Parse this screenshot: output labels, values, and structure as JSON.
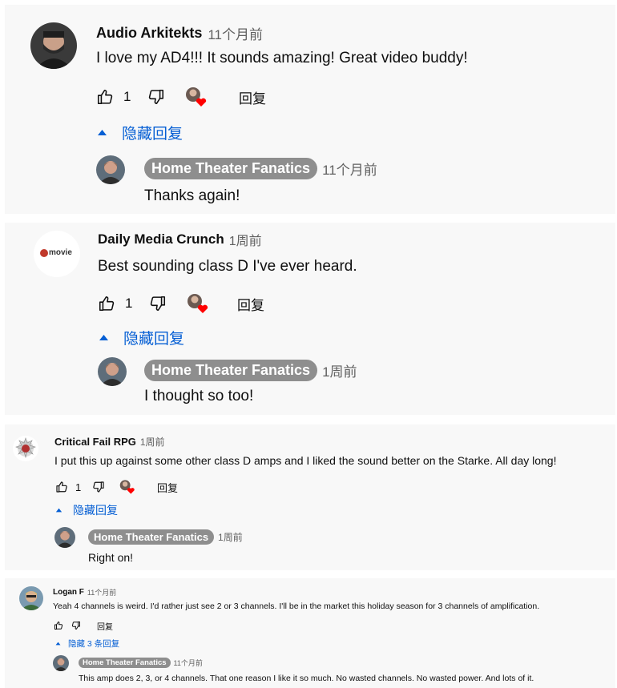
{
  "comments": [
    {
      "author": "Audio Arkitekts",
      "time": "11个月前",
      "text": "I love my AD4!!! It sounds amazing! Great video buddy!",
      "likes": "1",
      "reply_label": "回复",
      "toggle_label": "隐藏回复",
      "reply": {
        "author": "Home Theater Fanatics",
        "time": "11个月前",
        "text": "Thanks again!"
      }
    },
    {
      "author": "Daily Media Crunch",
      "time": "1周前",
      "logo_text": "movie",
      "text": "Best sounding class D I've ever heard.",
      "likes": "1",
      "reply_label": "回复",
      "toggle_label": "隐藏回复",
      "reply": {
        "author": "Home Theater Fanatics",
        "time": "1周前",
        "text": "I thought so too!"
      }
    },
    {
      "author": "Critical Fail RPG",
      "time": "1周前",
      "text": "I put this up against some other class D amps and I liked the sound better on the Starke. All day long!",
      "likes": "1",
      "reply_label": "回复",
      "toggle_label": "隐藏回复",
      "reply": {
        "author": "Home Theater Fanatics",
        "time": "1周前",
        "text": "Right on!"
      }
    },
    {
      "author": "Logan F",
      "time": "11个月前",
      "text": "Yeah 4 channels is weird.  I'd rather just see 2 or 3 channels.  I'll be in the market this holiday season for 3 channels of amplification.",
      "likes": "",
      "reply_label": "回复",
      "toggle_label": "隐藏 3 条回复",
      "reply": {
        "author": "Home Theater Fanatics",
        "time": "11个月前",
        "text": "This amp does 2, 3, or 4 channels. That one reason I like it so much. No wasted channels. No wasted power. And lots of it."
      }
    }
  ],
  "colors": {
    "link": "#065fd4",
    "card_bg": "#f8f8f8",
    "pill_bg": "#8e8e8e",
    "heart": "#ff0000"
  },
  "icons": [
    "thumb-up-icon",
    "thumb-down-icon",
    "creator-heart-icon",
    "caret-up-icon"
  ]
}
